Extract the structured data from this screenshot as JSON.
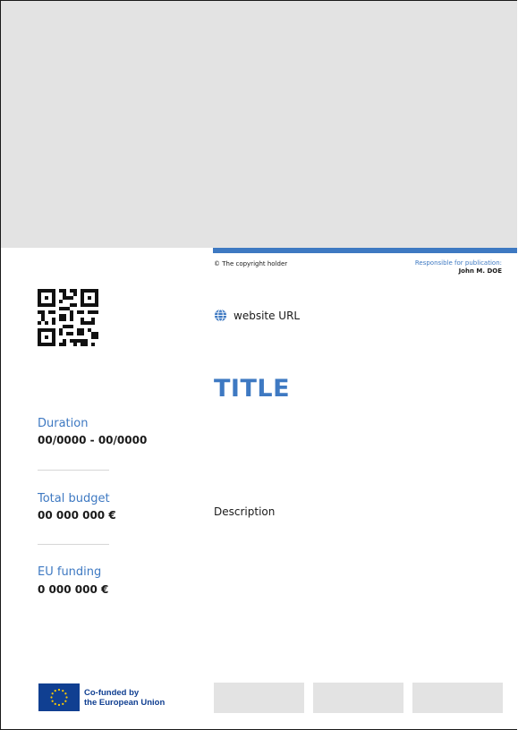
{
  "header": {
    "copyright": "© The copyright holder",
    "responsible_label": "Responsible for publication:",
    "responsible_name": "John M. DOE"
  },
  "website": {
    "label": "website URL",
    "icon": "globe-icon"
  },
  "main": {
    "title": "TITLE",
    "description": "Description"
  },
  "stats": [
    {
      "label": "Duration",
      "value": "00/0000 - 00/0000"
    },
    {
      "label": "Total budget",
      "value": "00 000 000 €"
    },
    {
      "label": "EU funding",
      "value": "0 000 000 €"
    }
  ],
  "footer": {
    "eu_line1": "Co-funded by",
    "eu_line2": "the European Union",
    "logo_placeholders": 3
  },
  "colors": {
    "accent": "#3e79c2",
    "placeholder": "#e3e3e3",
    "eu_blue": "#103f91",
    "eu_star": "#ffcc00",
    "text": "#1a1a1a"
  }
}
